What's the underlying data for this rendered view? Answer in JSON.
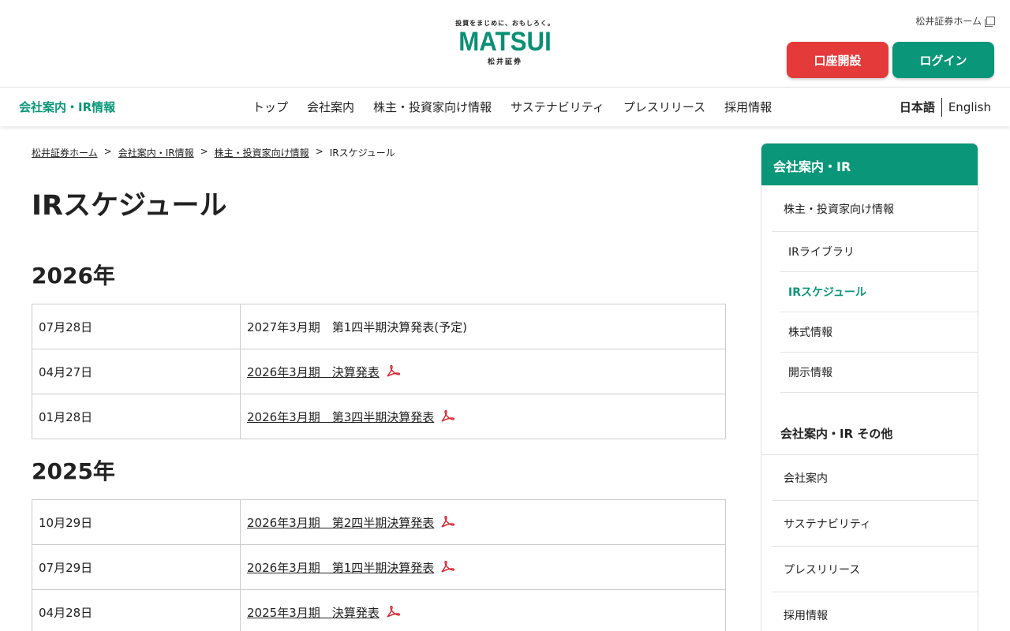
{
  "header": {
    "logo": {
      "tagline": "投資をまじめに、おもしろく。",
      "brand": "MATSUI",
      "kanji": "松井証券"
    },
    "home_link": "松井証券ホーム",
    "open_account": "口座開設",
    "login": "ログイン"
  },
  "nav": {
    "brand": "会社案内・IR情報",
    "items": [
      "トップ",
      "会社案内",
      "株主・投資家向け情報",
      "サステナビリティ",
      "プレスリリース",
      "採用情報"
    ],
    "lang_ja": "日本語",
    "lang_en": "English"
  },
  "breadcrumb": [
    "松井証券ホーム",
    "会社案内・IR情報",
    "株主・投資家向け情報",
    "IRスケジュール"
  ],
  "breadcrumb_sep": ">",
  "page_title": "IRスケジュール",
  "years": [
    {
      "label": "2026年",
      "rows": [
        {
          "date": "07月28日",
          "event": "2027年3月期　第1四半期決算発表(予定)",
          "link": false
        },
        {
          "date": "04月27日",
          "event": "2026年3月期　決算発表",
          "link": true
        },
        {
          "date": "01月28日",
          "event": "2026年3月期　第3四半期決算発表",
          "link": true
        }
      ]
    },
    {
      "label": "2025年",
      "rows": [
        {
          "date": "10月29日",
          "event": "2026年3月期　第2四半期決算発表",
          "link": true
        },
        {
          "date": "07月29日",
          "event": "2026年3月期　第1四半期決算発表",
          "link": true
        },
        {
          "date": "04月28日",
          "event": "2025年3月期　決算発表",
          "link": true
        }
      ]
    }
  ],
  "sidebar": {
    "title": "会社案内・IR",
    "investor_info": "株主・投資家向け情報",
    "sub_items": [
      "IRライブラリ",
      "IRスケジュール",
      "株式情報",
      "開示情報"
    ],
    "active": "IRスケジュール",
    "other_title": "会社案内・IR その他",
    "other_items": [
      "会社案内",
      "サステナビリティ",
      "プレスリリース",
      "採用情報"
    ]
  },
  "colors": {
    "brand_green": "#0a9678",
    "open_account_red": "#e43a3a",
    "pdf_red": "#d9232d"
  },
  "icons": {
    "pdf": "pdf-icon",
    "external": "external-link-icon"
  }
}
